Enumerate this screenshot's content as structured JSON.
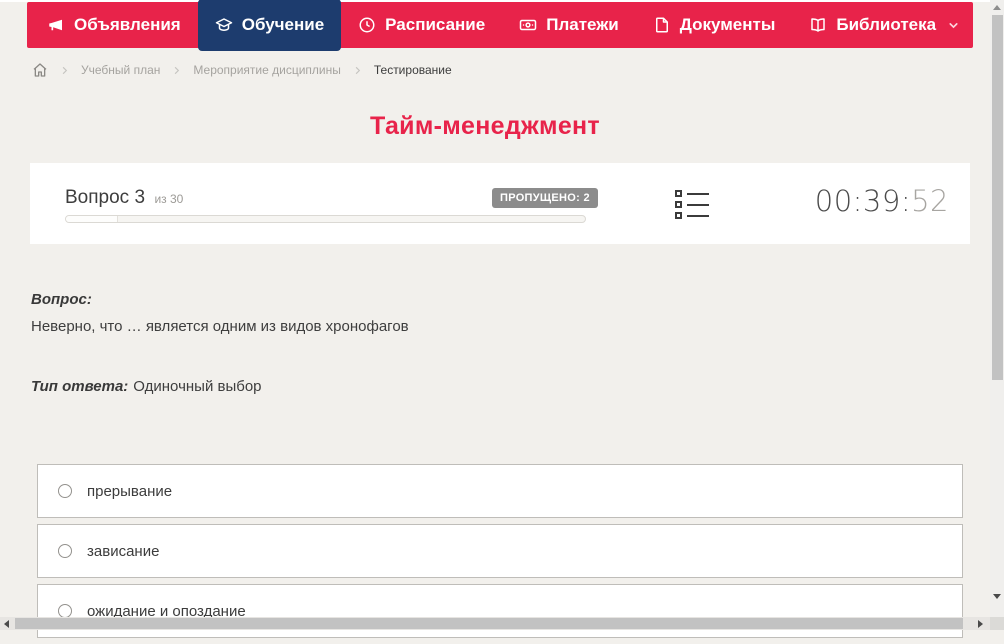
{
  "nav": {
    "items": [
      {
        "label": "Объявления"
      },
      {
        "label": "Обучение"
      },
      {
        "label": "Расписание"
      },
      {
        "label": "Платежи"
      },
      {
        "label": "Документы"
      },
      {
        "label": "Библиотека"
      }
    ]
  },
  "breadcrumb": {
    "items": [
      "Учебный план",
      "Мероприятие дисциплины",
      "Тестирование"
    ]
  },
  "page": {
    "title": "Тайм-менеджмент"
  },
  "quiz": {
    "question_label": "Вопрос 3",
    "question_of": "из 30",
    "skipped_badge": "ПРОПУЩЕНО: 2",
    "progress_percent": 10,
    "timer_main": "00:39:",
    "timer_seconds": "52",
    "question_heading": "Вопрос:",
    "question_text": "Неверно, что … является одним из видов хронофагов",
    "answer_type_label": "Тип ответа:",
    "answer_type_value": "Одиночный выбор",
    "options": [
      {
        "label": "прерывание"
      },
      {
        "label": "зависание"
      },
      {
        "label": "ожидание и опоздание"
      }
    ]
  },
  "colors": {
    "accent_red": "#e8234a",
    "accent_navy": "#1d3c6e",
    "badge_gray": "#8c8c8c"
  }
}
